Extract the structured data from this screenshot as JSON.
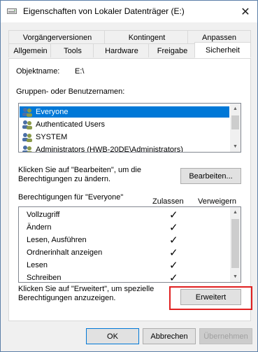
{
  "window": {
    "title": "Eigenschaften von Lokaler Datenträger (E:)",
    "close_glyph": "✕"
  },
  "tabs": {
    "row_top": [
      "Vorgängerversionen",
      "Kontingent",
      "Anpassen"
    ],
    "row_bottom": [
      "Allgemein",
      "Tools",
      "Hardware",
      "Freigabe",
      "Sicherheit"
    ],
    "active": "Sicherheit"
  },
  "security": {
    "object_label": "Objektname:",
    "object_value": "E:\\",
    "groups_label": "Gruppen- oder Benutzernamen:",
    "groups": [
      {
        "name": "Everyone",
        "selected": true,
        "icon": "users-icon"
      },
      {
        "name": "Authenticated Users",
        "selected": false,
        "icon": "users-icon"
      },
      {
        "name": "SYSTEM",
        "selected": false,
        "icon": "users-icon"
      },
      {
        "name": "Administrators (HWB-20DE\\Administrators)",
        "selected": false,
        "icon": "users-icon"
      }
    ],
    "edit_hint": "Klicken Sie auf \"Bearbeiten\", um die Berechtigungen zu ändern.",
    "edit_button": "Bearbeiten...",
    "perm_label": "Berechtigungen für \"Everyone\"",
    "allow_header": "Zulassen",
    "deny_header": "Verweigern",
    "permissions": [
      {
        "name": "Vollzugriff",
        "allow": "✓"
      },
      {
        "name": "Ändern",
        "allow": "✓"
      },
      {
        "name": "Lesen, Ausführen",
        "allow": "✓"
      },
      {
        "name": "Ordnerinhalt anzeigen",
        "allow": "✓"
      },
      {
        "name": "Lesen",
        "allow": "✓"
      },
      {
        "name": "Schreiben",
        "allow": "✓"
      }
    ],
    "advanced_hint": "Klicken Sie auf \"Erweitert\", um spezielle Berechtigungen anzuzeigen.",
    "advanced_button": "Erweitert",
    "highlight_color": "#e02020"
  },
  "footer": {
    "ok": "OK",
    "cancel": "Abbrechen",
    "apply": "Übernehmen"
  }
}
